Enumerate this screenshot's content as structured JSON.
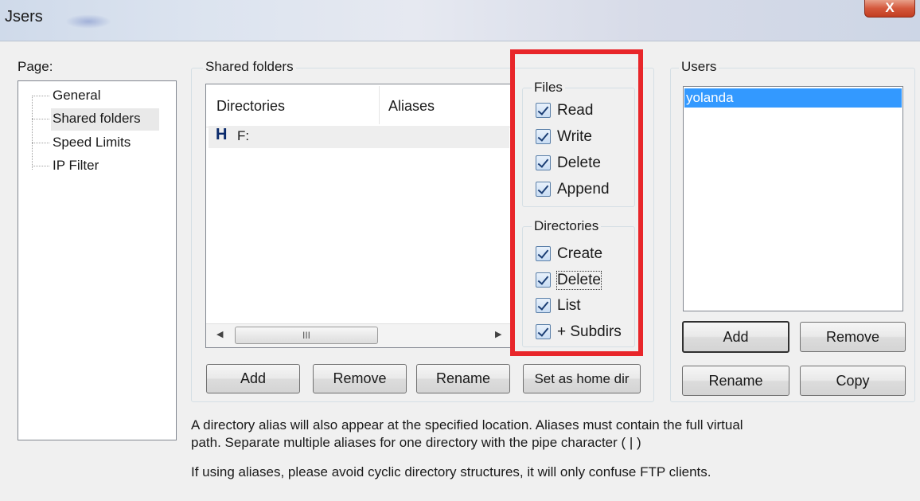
{
  "window": {
    "title": "Jsers",
    "close_label": "X"
  },
  "page_section": {
    "label": "Page:",
    "tree": [
      "General",
      "Shared folders",
      "Speed Limits",
      "IP Filter"
    ],
    "selected": "Shared folders"
  },
  "shared_folders": {
    "label": "Shared folders",
    "columns": [
      "Directories",
      "Aliases"
    ],
    "rows": [
      {
        "icon": "H",
        "directory": "F:",
        "alias": ""
      }
    ],
    "scroll_grip": "III",
    "buttons": {
      "add": "Add",
      "remove": "Remove",
      "rename": "Rename",
      "set_home": "Set as home dir"
    }
  },
  "files": {
    "label": "Files",
    "read": "Read",
    "write": "Write",
    "delete": "Delete",
    "append": "Append"
  },
  "directories": {
    "label": "Directories",
    "create": "Create",
    "delete": "Delete",
    "list": "List",
    "subdirs": "+ Subdirs"
  },
  "users": {
    "label": "Users",
    "items": [
      "yolanda"
    ],
    "buttons": {
      "add": "Add",
      "remove": "Remove",
      "rename": "Rename",
      "copy": "Copy"
    }
  },
  "notes": {
    "line1": "A directory alias will also appear at the specified location. Aliases must contain the full virtual",
    "line2": "path. Separate multiple aliases for one directory with the pipe character ( | )",
    "line3": "If using aliases, please avoid cyclic directory structures, it will only confuse FTP clients."
  },
  "colors": {
    "highlight_border": "#e8262a",
    "selection": "#3399ff"
  }
}
